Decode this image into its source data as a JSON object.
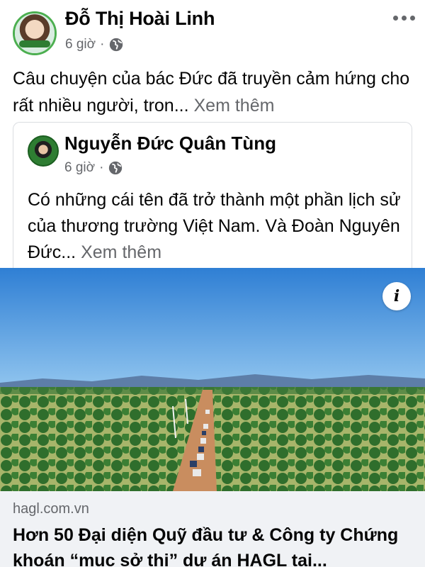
{
  "post": {
    "author": "Đỗ Thị Hoài Linh",
    "time": "6 giờ",
    "separator": "·",
    "text": "Câu chuyện của bác Đức đã truyền cảm hứng cho rất nhiều người, tron...",
    "see_more": "Xem thêm"
  },
  "shared": {
    "author": "Nguyễn Đức Quân Tùng",
    "time": "6 giờ",
    "separator": "·",
    "text": "Có những cái tên đã trở thành một phần lịch sử của thương trường Việt Nam. Và Đoàn Nguyên Đức...",
    "see_more": "Xem thêm"
  },
  "link": {
    "domain": "hagl.com.vn",
    "headline": "Hơn 50 Đại diện Quỹ đầu tư & Công ty Chứng khoán “mục sở thị” dự án HAGL tại..."
  },
  "icons": {
    "privacy": "globe-icon",
    "menu": "more-dots-icon",
    "info": "info-icon"
  },
  "colors": {
    "secondary_text": "#65676b",
    "link_background": "#f0f2f5",
    "sky": "#3f88d8"
  }
}
